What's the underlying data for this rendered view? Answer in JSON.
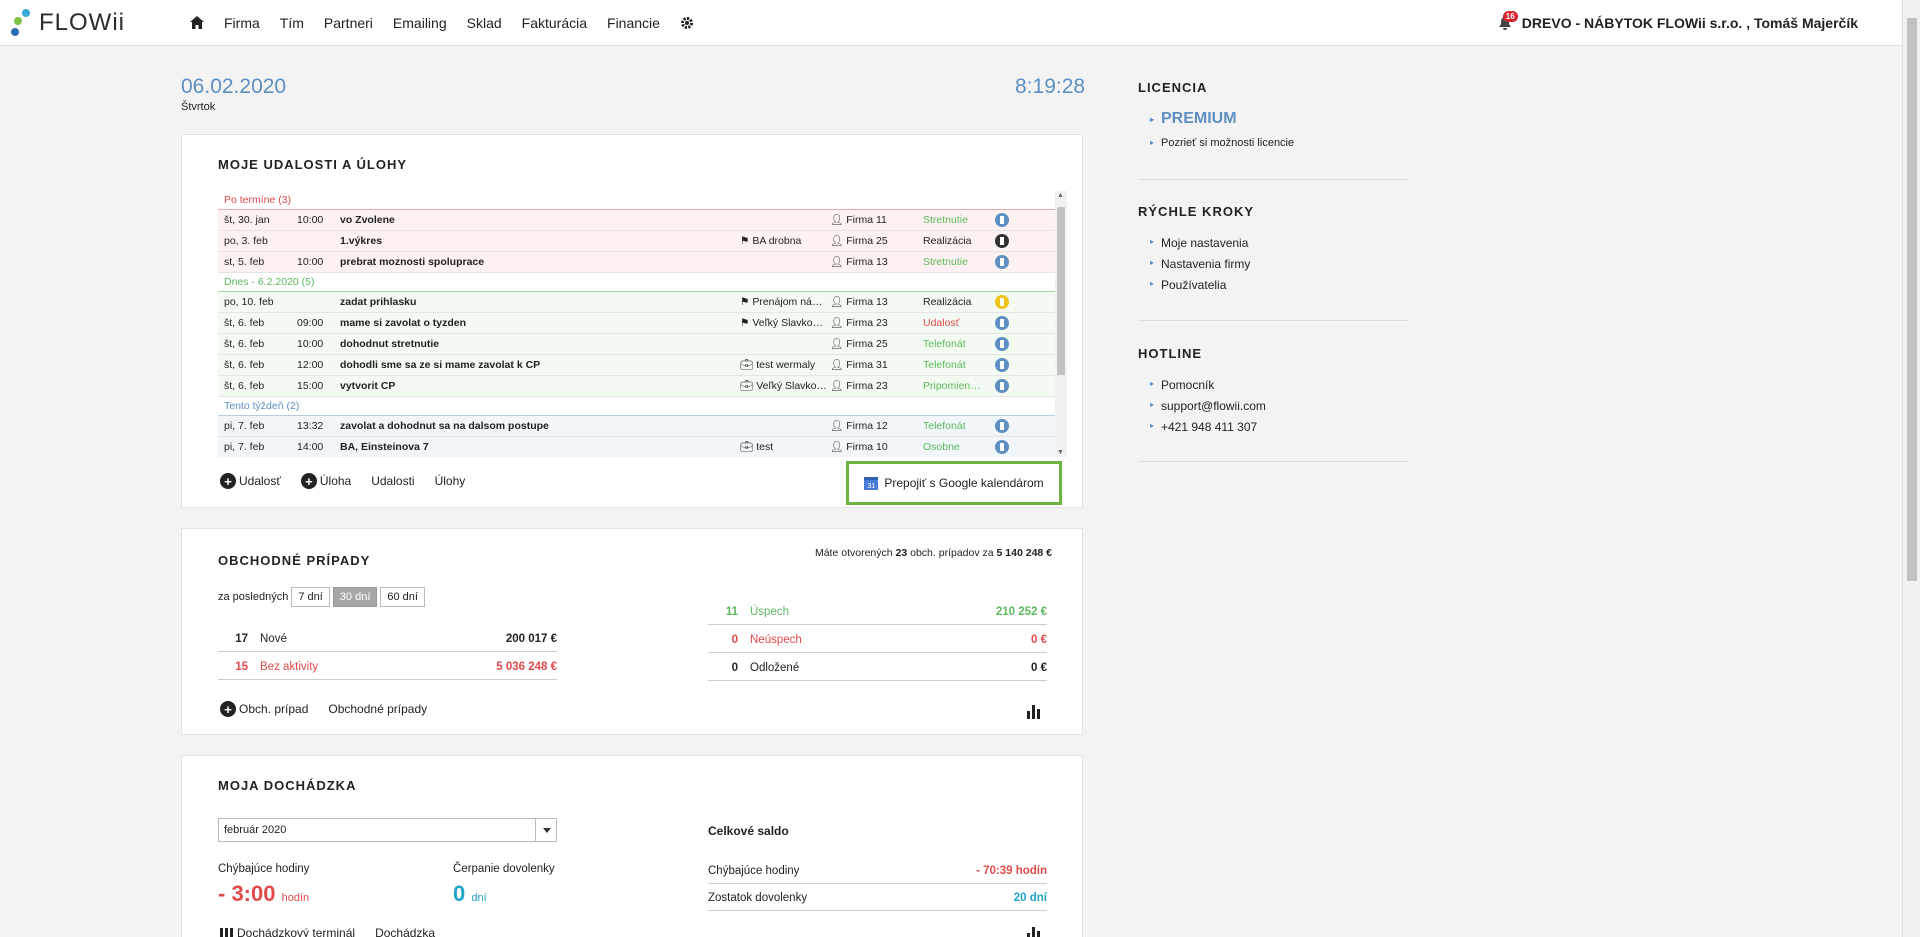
{
  "app": {
    "logo_text": "FLOWii"
  },
  "nav": {
    "items": [
      "Firma",
      "Tím",
      "Partneri",
      "Emailing",
      "Sklad",
      "Fakturácia",
      "Financie"
    ],
    "notification_count": "16",
    "user": "DREVO - NÁBYTOK FLOWii s.r.o. , Tomáš Majerčík"
  },
  "header": {
    "date": "06.02.2020",
    "weekday": "Štvrtok",
    "time": "8:19:28"
  },
  "events": {
    "title": "MOJE UDALOSTI A ÚLOHY",
    "groups": {
      "late": "Po termíne (3)",
      "today": "Dnes - 6.2.2020 (5)",
      "week": "Tento týždeň (2)"
    },
    "rows": [
      {
        "date": "št, 30. jan",
        "time": "10:00",
        "title": "vo Zvolene",
        "project": "",
        "firm": "Firma 11",
        "type": "Stretnutie"
      },
      {
        "date": "po, 3. feb",
        "time": "",
        "title": "1.výkres",
        "project": "BA drobna",
        "firm": "Firma 25",
        "type": "Realizácia"
      },
      {
        "date": "st, 5. feb",
        "time": "10:00",
        "title": "prebrat moznosti spoluprace",
        "project": "",
        "firm": "Firma 13",
        "type": "Stretnutie"
      },
      {
        "date": "po, 10. feb",
        "time": "",
        "title": "zadat prihlasku",
        "project": "Prenájom ná…",
        "firm": "Firma 13",
        "type": "Realizácia"
      },
      {
        "date": "št, 6. feb",
        "time": "09:00",
        "title": "mame si zavolat o tyzden",
        "project": "Veľký Slavko…",
        "firm": "Firma 23",
        "type": "Udalosť"
      },
      {
        "date": "št, 6. feb",
        "time": "10:00",
        "title": "dohodnut stretnutie",
        "project": "",
        "firm": "Firma 25",
        "type": "Telefonát"
      },
      {
        "date": "št, 6. feb",
        "time": "12:00",
        "title": "dohodli sme sa ze si mame zavolat k CP",
        "project": "test wermaly",
        "firm": "Firma 31",
        "type": "Telefonát"
      },
      {
        "date": "št, 6. feb",
        "time": "15:00",
        "title": "vytvorit CP",
        "project": "Veľký Slavko…",
        "firm": "Firma 23",
        "type": "Pripomien…"
      },
      {
        "date": "pi, 7. feb",
        "time": "13:32",
        "title": "zavolat a dohodnut sa na dalsom postupe",
        "project": "",
        "firm": "Firma 12",
        "type": "Telefonát"
      },
      {
        "date": "pi, 7. feb",
        "time": "14:00",
        "title": "BA, Einsteinova 7",
        "project": "test",
        "firm": "Firma 10",
        "type": "Osobne"
      }
    ],
    "footer": {
      "add_event": "Udalosť",
      "add_task": "Úloha",
      "events_link": "Udalosti",
      "tasks_link": "Úlohy",
      "gcal_button": "Prepojiť s Google kalendárom",
      "gcal_icon_text": "31"
    }
  },
  "cases": {
    "title": "OBCHODNÉ PRÍPADY",
    "summary_prefix": "Máte otvorených",
    "summary_count": "23",
    "summary_mid": "obch. prípadov za",
    "summary_value": "5 140 248 €",
    "filter_label": "za posledných",
    "filters": [
      "7 dní",
      "30 dní",
      "60 dní"
    ],
    "left_stats": [
      {
        "num": "17",
        "label": "Nové",
        "value": "200 017 €"
      },
      {
        "num": "15",
        "label": "Bez aktivity",
        "value": "5 036 248 €"
      }
    ],
    "right_stats": [
      {
        "num": "11",
        "label": "Úspech",
        "value": "210 252 €"
      },
      {
        "num": "0",
        "label": "Neúspech",
        "value": "0 €"
      },
      {
        "num": "0",
        "label": "Odložené",
        "value": "0 €"
      }
    ],
    "add_case": "Obch. prípad",
    "cases_link": "Obchodné prípady"
  },
  "attendance": {
    "title": "MOJA DOCHÁDZKA",
    "month": "február 2020",
    "missing_label": "Chýbajúce hodiny",
    "missing_value": "- 3:00",
    "missing_unit": "hodín",
    "leave_label": "Čerpanie dovolenky",
    "leave_value": "0",
    "leave_unit": "dní",
    "total_title": "Celkové saldo",
    "total_missing_label": "Chýbajúce hodiny",
    "total_missing_value": "- 70:39 hodín",
    "total_leave_label": "Zostatok dovolenky",
    "total_leave_value": "20 dní",
    "terminal_link": "Dochádzkový terminál",
    "attendance_link": "Dochádzka"
  },
  "sidebar": {
    "license_title": "LICENCIA",
    "plan": "PREMIUM",
    "plan_link": "Pozrieť si možnosti licencie",
    "quick_title": "RÝCHLE KROKY",
    "quick": [
      "Moje nastavenia",
      "Nastavenia firmy",
      "Používatelia"
    ],
    "hotline_title": "HOTLINE",
    "hotline": [
      "Pomocník",
      "support@flowii.com",
      "+421 948 411 307"
    ]
  }
}
